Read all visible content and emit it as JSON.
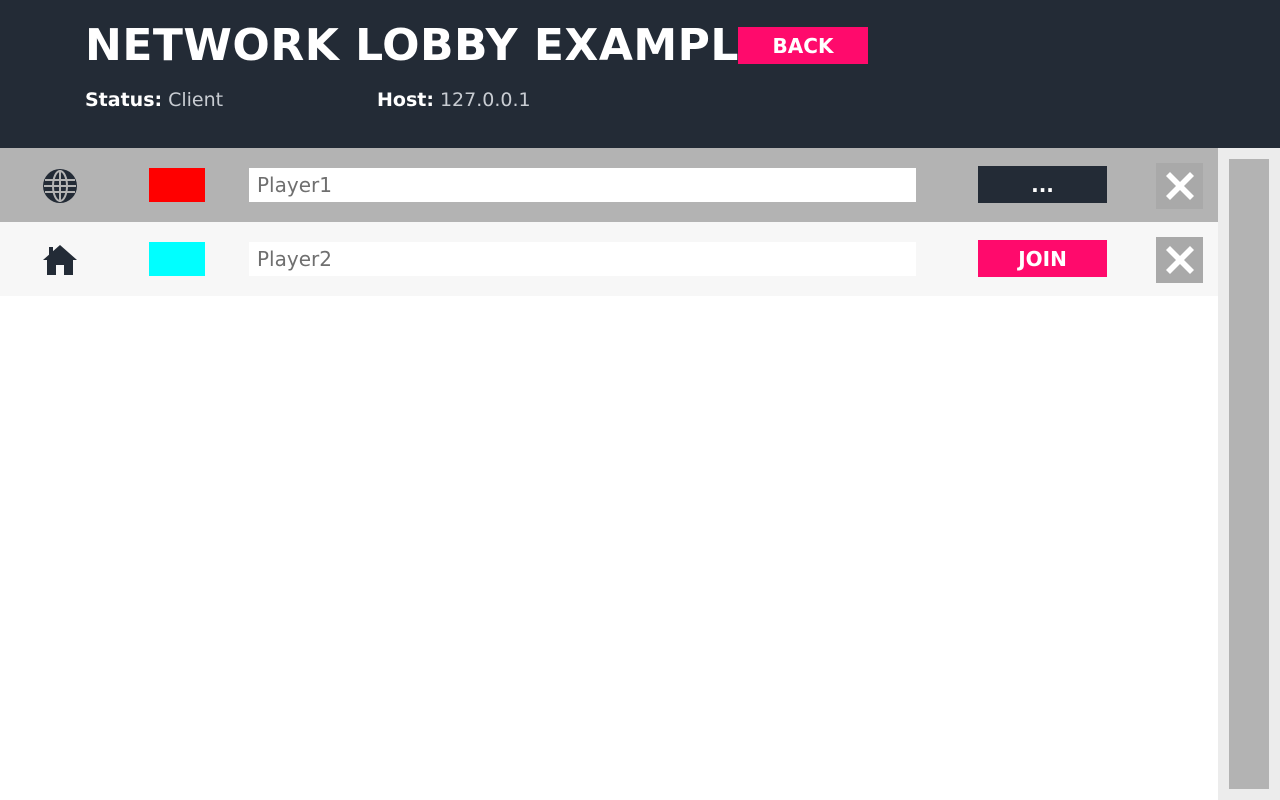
{
  "header": {
    "title": "NETWORK LOBBY EXAMPLE",
    "back_label": "BACK",
    "status_label": "Status:",
    "status_value": "Client",
    "host_label": "Host:",
    "host_value": "127.0.0.1"
  },
  "players": [
    {
      "icon": "globe-icon",
      "color": "#ff0000",
      "name": "Player1",
      "action_label": "...",
      "action_style": "dark"
    },
    {
      "icon": "home-icon",
      "color": "#00ffff",
      "name": "Player2",
      "action_label": "JOIN",
      "action_style": "pink"
    }
  ],
  "colors": {
    "header_bg": "#232b36",
    "accent": "#ff0a6c",
    "row_selected": "#b3b3b3",
    "row_normal": "#f7f7f7"
  }
}
